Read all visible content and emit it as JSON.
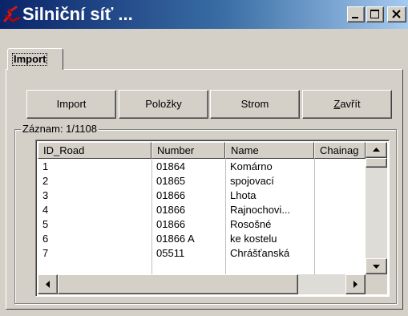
{
  "window": {
    "title": "Silniční síť ...",
    "app_icon": "red-road-icon",
    "controls": {
      "minimize": "minimize-icon",
      "maximize": "maximize-icon",
      "close": "close-icon"
    }
  },
  "tabs": [
    {
      "label": "Import",
      "selected": true
    }
  ],
  "toolbar": {
    "import_label": "Import",
    "items_label": "Položky",
    "tree_label": "Strom",
    "close_label_pre": "",
    "close_label_underlined": "Z",
    "close_label_rest": "avřít"
  },
  "records": {
    "label": "Záznam: 1/1108",
    "columns": [
      "ID_Road",
      "Number",
      "Name",
      "Chainag"
    ],
    "rows": [
      [
        "1",
        "01864",
        "Komárno",
        ""
      ],
      [
        "2",
        "01865",
        "spojovací",
        ""
      ],
      [
        "3",
        "01866",
        "Lhota",
        ""
      ],
      [
        "4",
        "01866",
        "Rajnochovi...",
        ""
      ],
      [
        "5",
        "01866",
        "Rosošné",
        ""
      ],
      [
        "6",
        "01866 A",
        "ke kostelu",
        ""
      ],
      [
        "7",
        "05511",
        "Chrášťanská",
        ""
      ]
    ]
  },
  "colors": {
    "face": "#d4d0c8",
    "title_start": "#0a246a",
    "title_end": "#a6caf0",
    "list_bg": "#ffffff"
  }
}
